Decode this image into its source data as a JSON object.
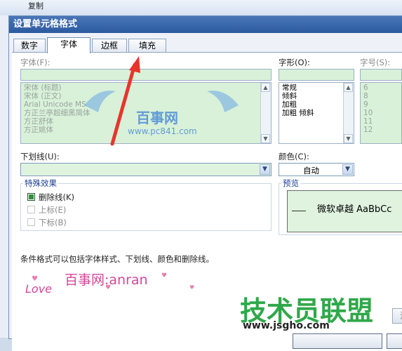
{
  "background": {
    "copy_label": "复制"
  },
  "dialog": {
    "title": "设置单元格格式",
    "tabs": [
      {
        "label": "数字"
      },
      {
        "label": "字体"
      },
      {
        "label": "边框"
      },
      {
        "label": "填充"
      }
    ],
    "font": {
      "label": "字体(F):",
      "items": [
        "宋体 (标题)",
        "宋体 (正文)",
        "Arial Unicode MS",
        "方正兰亭超细黑简体",
        "方正舒体",
        "方正姚体"
      ]
    },
    "style": {
      "label": "字形(O):",
      "items": [
        "常规",
        "倾斜",
        "加粗",
        "加粗 倾斜"
      ]
    },
    "size": {
      "label": "字号(S):",
      "items": [
        "6",
        "8",
        "9",
        "10",
        "11",
        "12"
      ]
    },
    "underline": {
      "label": "下划线(U):",
      "value": ""
    },
    "color": {
      "label": "颜色(C):",
      "value": "自动"
    },
    "effects": {
      "label": "特殊效果",
      "strikethrough": {
        "label": "删除线(K)",
        "checked": true
      },
      "superscript": {
        "label": "上标(E)",
        "checked": false
      },
      "subscript": {
        "label": "下标(B)",
        "checked": false
      }
    },
    "preview": {
      "label": "预览",
      "sample": "微软卓越 AaBbCc"
    },
    "note": "条件格式可以包括字体样式、下划线、颜色和删除线。",
    "clear_label": "清"
  },
  "watermarks": {
    "baishi_text": "百事网",
    "baishi_url": "www.pc841.com",
    "anran": "百事网:anran",
    "love": "Love",
    "site_title": "技术员联盟",
    "site_url": "www.jsgho.com"
  },
  "colors": {
    "title_bar": "#2c5aa0",
    "arrow": "#e8342c",
    "list_bg": "#d8f1d8"
  }
}
